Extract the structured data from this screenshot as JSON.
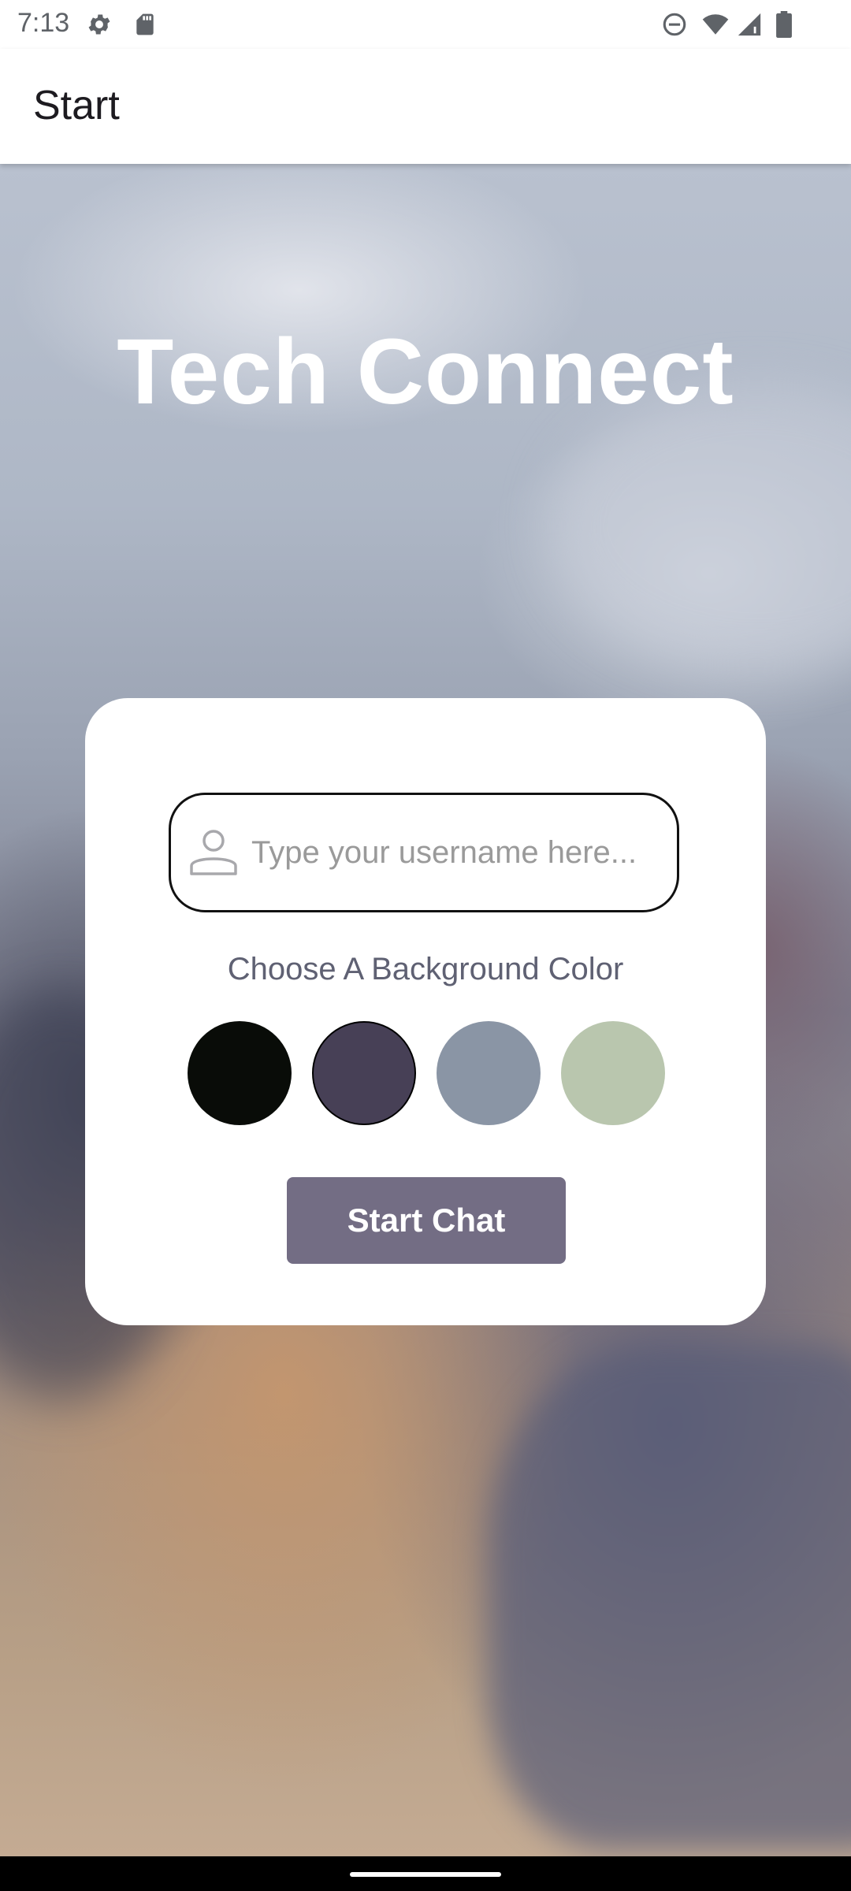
{
  "status_bar": {
    "time": "7:13",
    "icons": [
      "settings-icon",
      "sd-card-icon",
      "do-not-disturb-icon",
      "wifi-icon",
      "cellular-signal-icon",
      "battery-icon"
    ]
  },
  "app_bar": {
    "title": "Start"
  },
  "app_title": "Tech Connect",
  "form": {
    "username_placeholder": "Type your username here...",
    "username_value": "",
    "user_icon": "person-icon",
    "color_label": "Choose A Background Color",
    "colors": [
      "#090c08",
      "#474056",
      "#8a95a5",
      "#b9c6ae"
    ],
    "selected_color_index": 1,
    "start_button": "Start Chat"
  },
  "colors": {
    "button": "#736d84",
    "input_border": "#111111",
    "title_text": "#ffffff"
  }
}
